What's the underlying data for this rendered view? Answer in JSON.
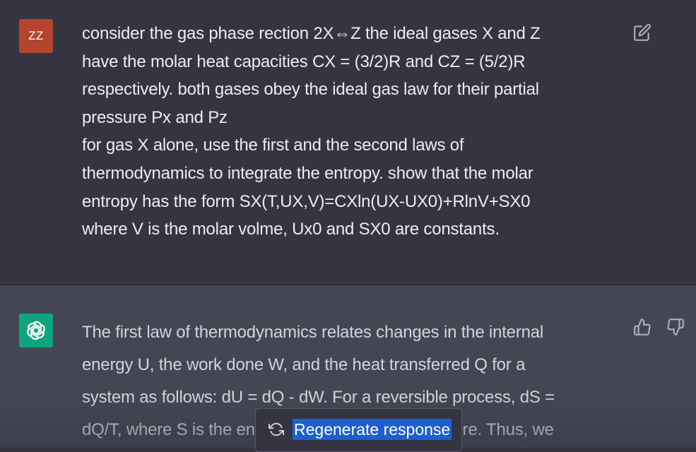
{
  "user_message": {
    "avatar_text": "ZZ",
    "lines": [
      "consider the gas phase rection 2X⇔Z the ideal gases X and Z",
      "have the molar heat capacities CX = (3/2)R and CZ = (5/2)R",
      "respectively. both gases obey the ideal gas law for their partial",
      "pressure Px and Pz",
      "for gas X alone, use the first and the second laws of",
      "thermodynamics to integrate the entropy. show that the molar",
      "entropy has the form SX(T,UX,V)=CXln(UX-UX0)+RlnV+SX0",
      "where V is the molar volme, Ux0 and SX0 are constants."
    ],
    "edit_icon": "edit-icon"
  },
  "assistant_message": {
    "avatar_icon": "openai-logo-icon",
    "lines": [
      "The first law of thermodynamics relates changes in the internal",
      "energy U, the work done W, and the heat transferred Q for a",
      "system as follows: dU = dQ - dW. For a reversible process, dS =",
      "dQ/T, where S is the entropy and T is the temperature. Thus, we"
    ],
    "thumbs_up_icon": "thumbs-up-icon",
    "thumbs_down_icon": "thumbs-down-icon"
  },
  "regenerate": {
    "label": "Regenerate response",
    "icon": "refresh-icon"
  },
  "colors": {
    "background": "#343541",
    "assistant_background": "#444654",
    "user_avatar": "#b5442f",
    "gpt_avatar": "#10a37f",
    "text": "#ececf1",
    "highlight": "#1c5fd1"
  }
}
